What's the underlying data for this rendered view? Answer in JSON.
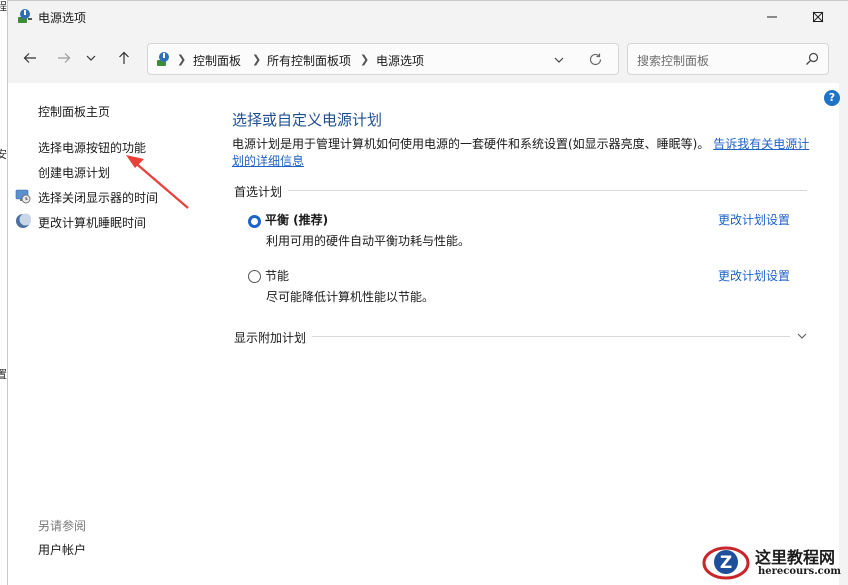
{
  "window": {
    "title": "电源选项"
  },
  "nav": {
    "breadcrumb": [
      "控制面板",
      "所有控制面板项",
      "电源选项"
    ],
    "search_placeholder": "搜索控制面板"
  },
  "sidebar": {
    "home": "控制面板主页",
    "links": [
      {
        "label": "选择电源按钮的功能",
        "icon": null
      },
      {
        "label": "创建电源计划",
        "icon": null
      },
      {
        "label": "选择关闭显示器的时间",
        "icon": "monitor-clock-icon"
      },
      {
        "label": "更改计算机睡眠时间",
        "icon": "moon-icon"
      }
    ],
    "see_also_heading": "另请参阅",
    "see_also_links": [
      "用户帐户"
    ]
  },
  "main": {
    "heading": "选择或自定义电源计划",
    "description": "电源计划是用于管理计算机如何使用电源的一套硬件和系统设置(如显示器亮度、睡眠等)。",
    "description_link": "告诉我有关电源计划的详细信息",
    "preferred_label": "首选计划",
    "plans": [
      {
        "name": "平衡 (推荐)",
        "description": "利用可用的硬件自动平衡功耗与性能。",
        "selected": true,
        "link": "更改计划设置"
      },
      {
        "name": "节能",
        "description": "尽可能降低计算机性能以节能。",
        "selected": false,
        "link": "更改计划设置"
      }
    ],
    "more_plans_label": "显示附加计划"
  },
  "watermark": {
    "title": "这里教程网",
    "url": "herecours.com"
  },
  "colors": {
    "accent": "#1f63c7",
    "heading": "#1f4e93",
    "annotation_arrow": "#e8413a"
  },
  "left_edge_fragments": [
    "程",
    "安",
    "置"
  ]
}
